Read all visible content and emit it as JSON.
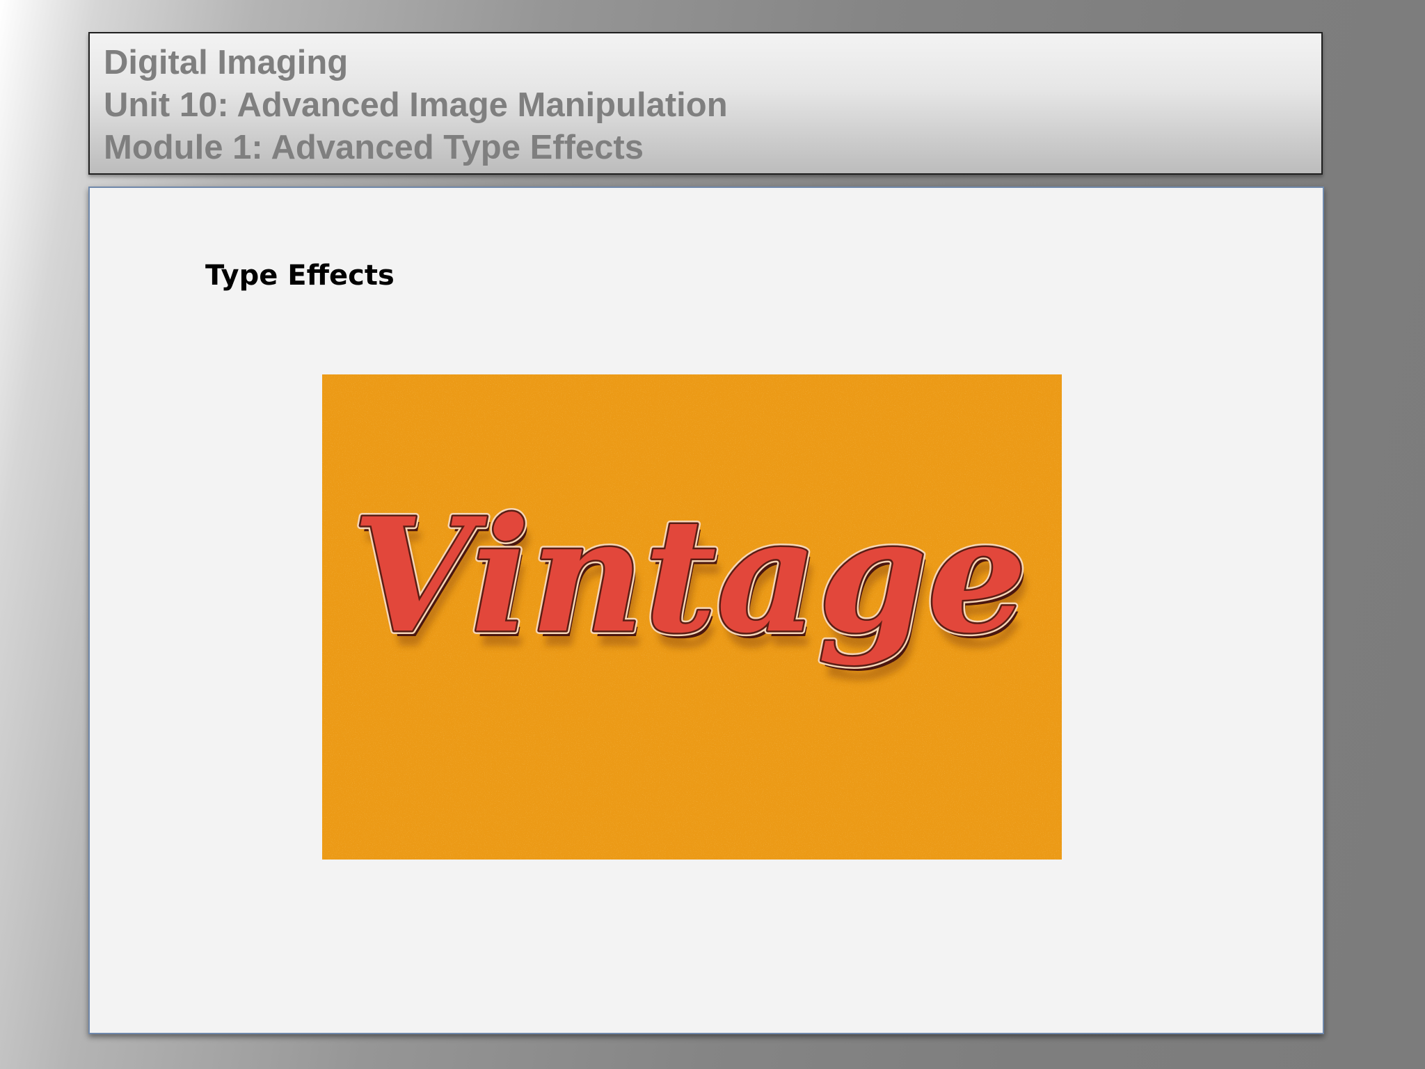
{
  "header": {
    "course": "Digital Imaging",
    "unit": "Unit 10: Advanced Image Manipulation",
    "module": "Module 1: Advanced Type Effects"
  },
  "slide": {
    "heading": "Type Effects"
  },
  "image": {
    "word": "Vintage",
    "background_color": "#ec9a16",
    "text_color": "#e2473b",
    "outline_color": "#5a1d14",
    "highlight_color": "#f6d7b8"
  }
}
